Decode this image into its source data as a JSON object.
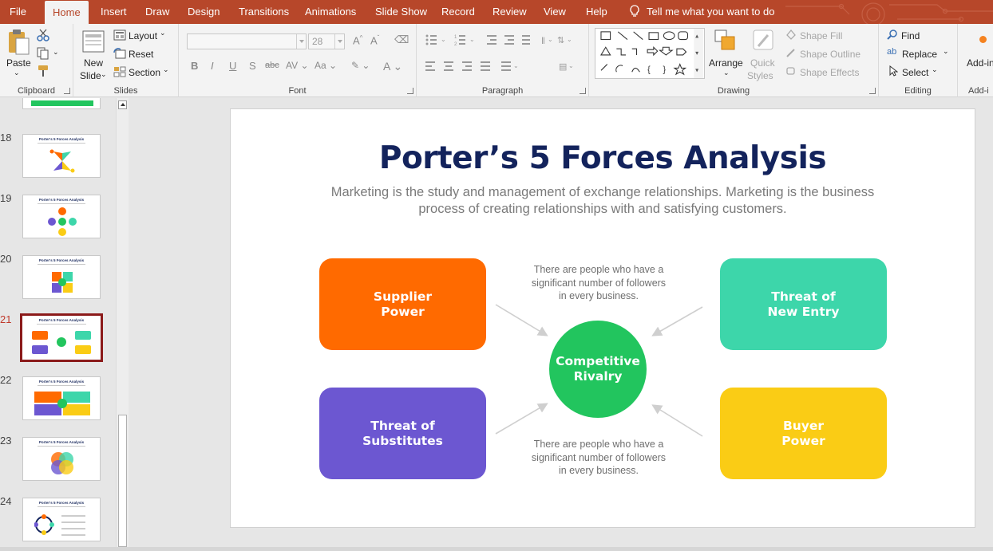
{
  "tabs": [
    "File",
    "Home",
    "Insert",
    "Draw",
    "Design",
    "Transitions",
    "Animations",
    "Slide Show",
    "Record",
    "Review",
    "View",
    "Help"
  ],
  "active_tab": "Home",
  "tell_me": "Tell me what you want to do",
  "ribbon": {
    "clipboard": {
      "paste": "Paste",
      "label": "Clipboard"
    },
    "slides": {
      "new_slide_line1": "New",
      "new_slide_line2": "Slide",
      "layout": "Layout",
      "reset": "Reset",
      "section": "Section",
      "label": "Slides"
    },
    "font": {
      "size": "28",
      "label": "Font"
    },
    "paragraph": {
      "label": "Paragraph"
    },
    "drawing": {
      "arrange": "Arrange",
      "quick_styles_line1": "Quick",
      "quick_styles_line2": "Styles",
      "shape_fill": "Shape Fill",
      "shape_outline": "Shape Outline",
      "shape_effects": "Shape Effects",
      "label": "Drawing"
    },
    "editing": {
      "find": "Find",
      "replace": "Replace",
      "select": "Select",
      "label": "Editing"
    },
    "addins": {
      "top": "Add-in",
      "label": "Add-i"
    }
  },
  "thumbnails": [
    {
      "num": "18",
      "title": "Porter's 5 Forces Analysis",
      "selected": false
    },
    {
      "num": "19",
      "title": "Porter's 5 Forces Analysis",
      "selected": false
    },
    {
      "num": "20",
      "title": "Porter's 5 Forces Analysis",
      "selected": false
    },
    {
      "num": "21",
      "title": "Porter's 5 Forces Analysis",
      "selected": true
    },
    {
      "num": "22",
      "title": "Porter's 5 Forces Analysis",
      "selected": false
    },
    {
      "num": "23",
      "title": "Porter's 5 Forces Analysis",
      "selected": false
    },
    {
      "num": "24",
      "title": "Porter's 5 Forces Analysis",
      "selected": false
    }
  ],
  "slide": {
    "title": "Porter’s 5 Forces Analysis",
    "subtitle": "Marketing is the study and management of exchange relationships. Marketing is the business process of creating relationships with and satisfying customers.",
    "supplier_power_l1": "Supplier",
    "supplier_power_l2": "Power",
    "new_entry_l1": "Threat of",
    "new_entry_l2": "New Entry",
    "substitutes_l1": "Threat of",
    "substitutes_l2": "Substitutes",
    "buyer_power_l1": "Buyer",
    "buyer_power_l2": "Power",
    "rivalry_l1": "Competitive",
    "rivalry_l2": "Rivalry",
    "note_top_l1": "There are people who have a",
    "note_top_l2": "significant number of followers",
    "note_top_l3": "in every business.",
    "note_bottom_l1": "There are people who have a",
    "note_bottom_l2": "significant number of followers",
    "note_bottom_l3": "in every business."
  },
  "colors": {
    "accent": "#b7472a",
    "supplier": "#ff6a00",
    "new_entry": "#3dd6aa",
    "substitutes": "#6c57d1",
    "buyer": "#facc15",
    "rivalry": "#22c55e",
    "title": "#13235c"
  }
}
